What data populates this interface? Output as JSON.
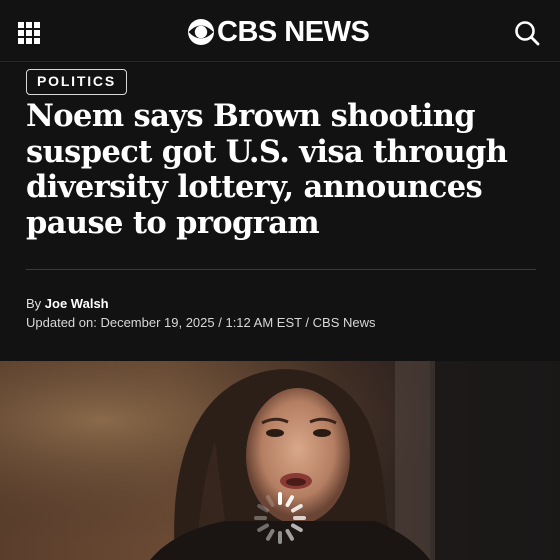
{
  "header": {
    "brand": "CBS NEWS",
    "menu_icon": "grid-menu-icon",
    "search_icon": "search-icon",
    "logo_icon": "cbs-eye-icon"
  },
  "article": {
    "category": "POLITICS",
    "headline": "Noem says Brown shooting suspect got U.S. visa through diversity lottery, announces pause to program",
    "by_prefix": "By",
    "author": "Joe Walsh",
    "updated": "Updated on: December 19, 2025 / 1:12 AM EST / CBS News"
  },
  "media": {
    "state": "loading",
    "spinner_icon": "loading-spinner-icon"
  },
  "colors": {
    "background": "#121212",
    "text": "#ffffff"
  }
}
